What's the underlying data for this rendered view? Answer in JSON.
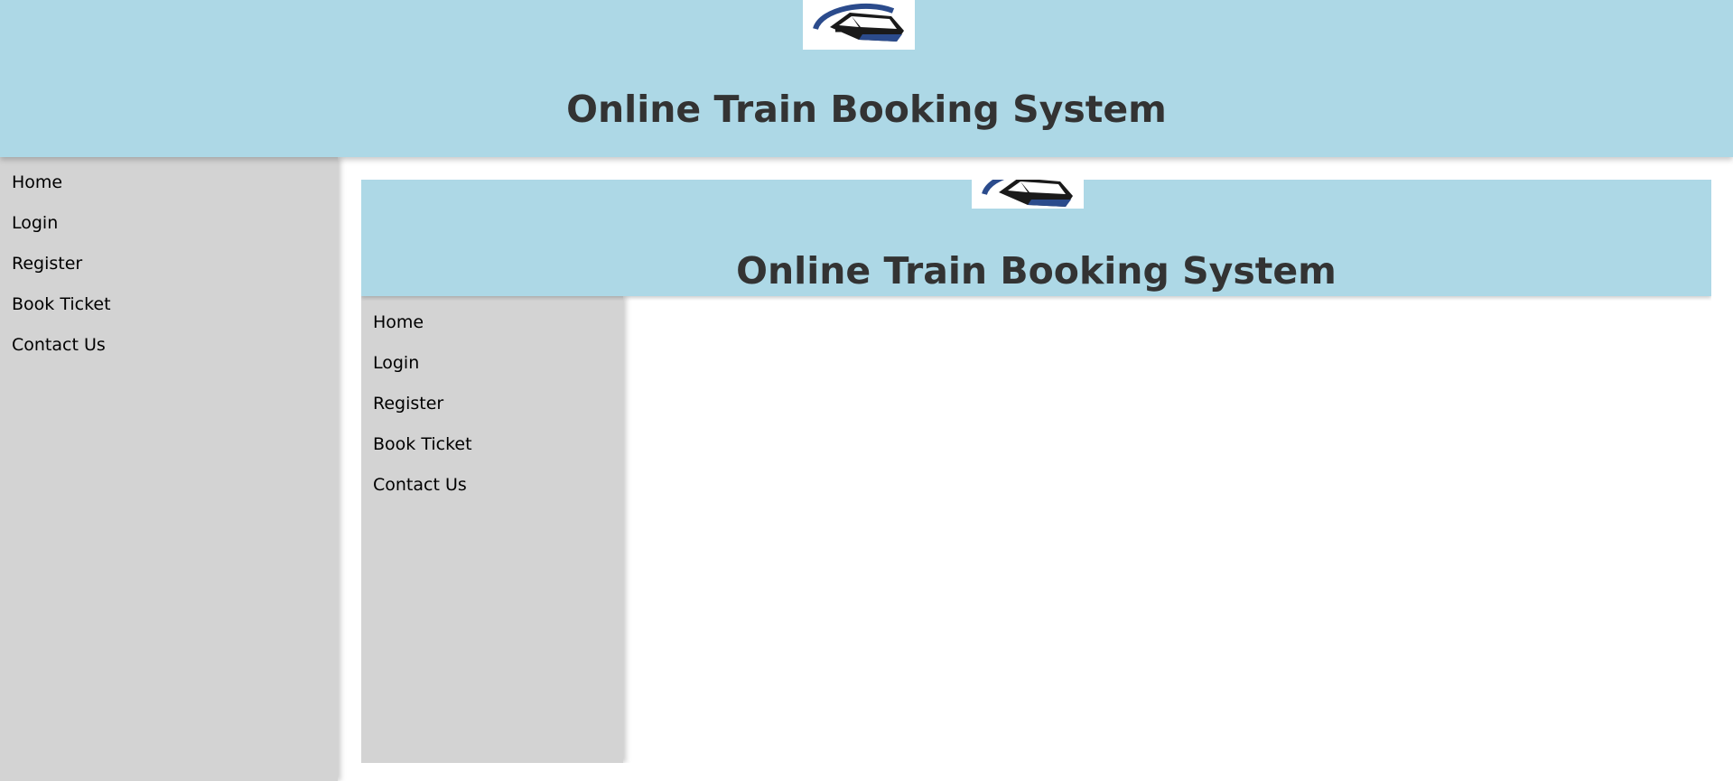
{
  "header": {
    "title": "Online Train Booking System",
    "logo_icon": "train-logo-icon"
  },
  "sidebar": {
    "items": [
      {
        "label": "Home"
      },
      {
        "label": "Login"
      },
      {
        "label": "Register"
      },
      {
        "label": "Book Ticket"
      },
      {
        "label": "Contact Us"
      }
    ]
  },
  "frame": {
    "header": {
      "title": "Online Train Booking System",
      "logo_icon": "train-logo-icon"
    },
    "sidebar": {
      "items": [
        {
          "label": "Home"
        },
        {
          "label": "Login"
        },
        {
          "label": "Register"
        },
        {
          "label": "Book Ticket"
        },
        {
          "label": "Contact Us"
        }
      ]
    }
  },
  "colors": {
    "header_bg": "#add8e6",
    "sidebar_bg": "#d3d3d3",
    "title_text": "#333333",
    "logo_blue": "#2b4b8c"
  }
}
